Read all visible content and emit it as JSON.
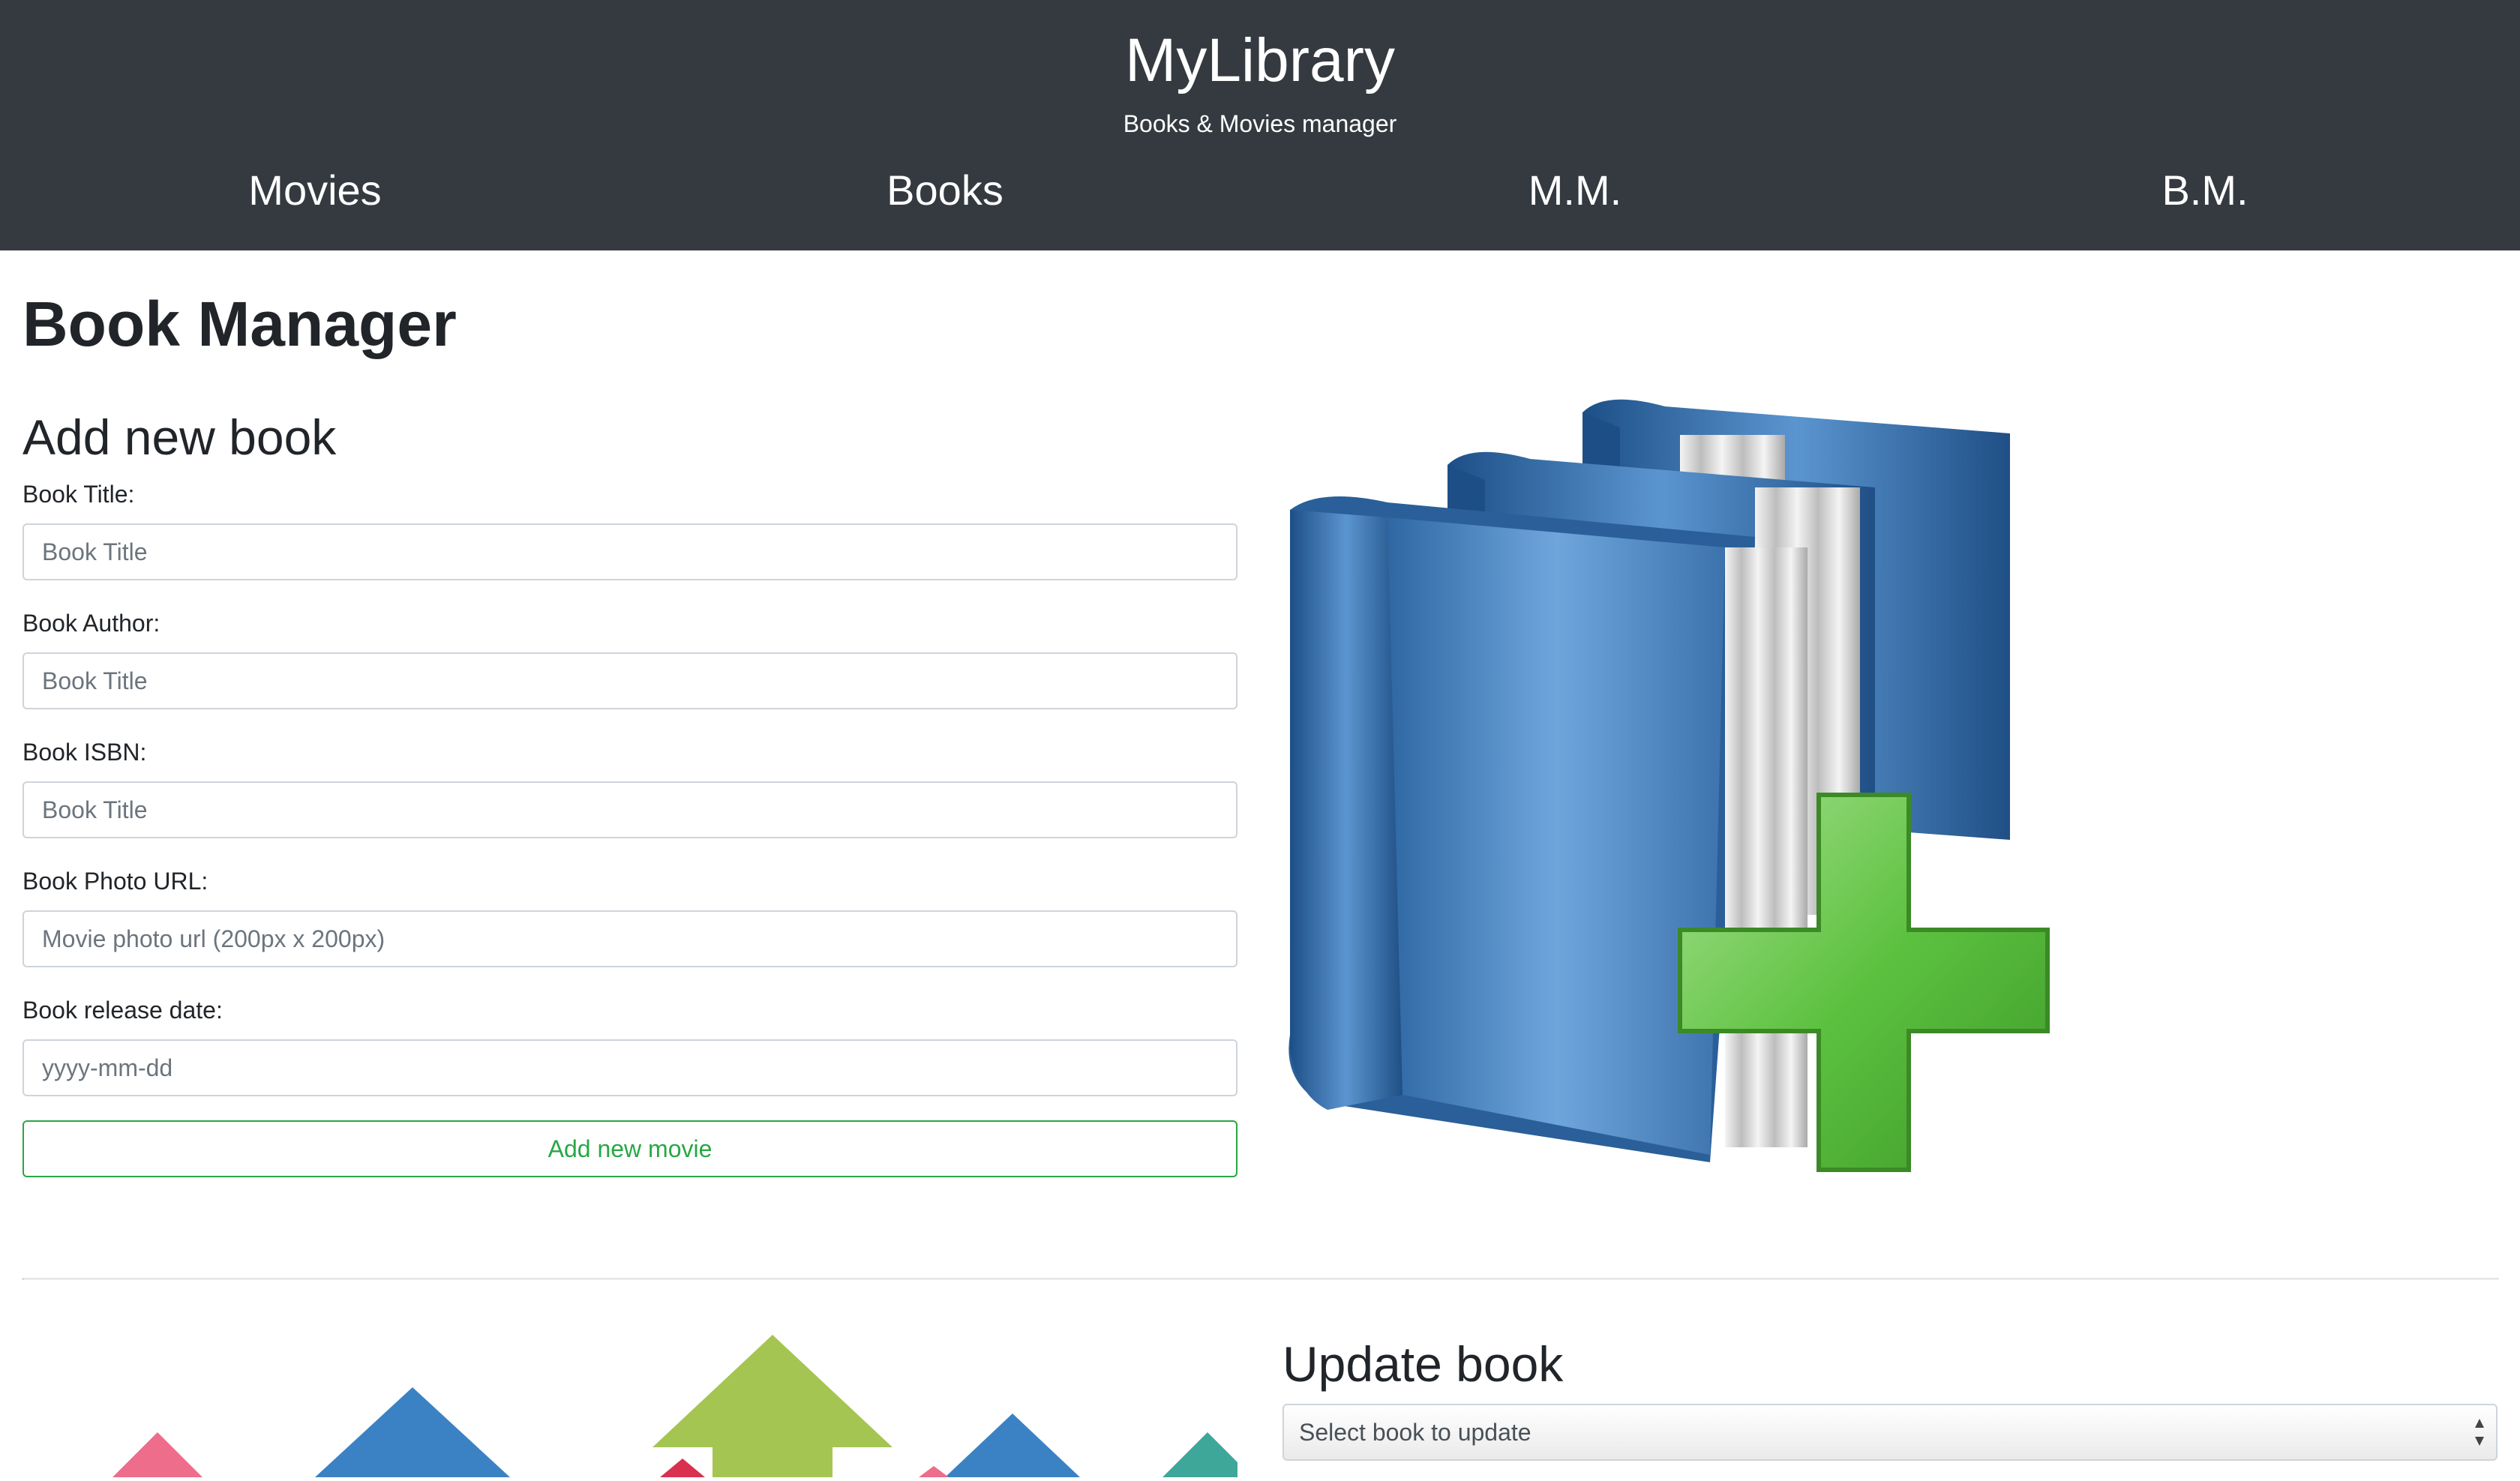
{
  "header": {
    "brand": "MyLibrary",
    "tagline": "Books & Movies manager",
    "nav": [
      "Movies",
      "Books",
      "M.M.",
      "B.M."
    ]
  },
  "page": {
    "title": "Book Manager"
  },
  "add_form": {
    "title": "Add new book",
    "fields": [
      {
        "label": "Book Title:",
        "placeholder": "Book Title",
        "value": ""
      },
      {
        "label": "Book Author:",
        "placeholder": "Book Title",
        "value": ""
      },
      {
        "label": "Book ISBN:",
        "placeholder": "Book Title",
        "value": ""
      },
      {
        "label": "Book Photo URL:",
        "placeholder": "Movie photo url (200px x 200px)",
        "value": ""
      },
      {
        "label": "Book release date:",
        "placeholder": "yyyy-mm-dd",
        "value": ""
      }
    ],
    "submit_label": "Add new movie"
  },
  "update_form": {
    "title": "Update book",
    "select_value": "Select book to update"
  },
  "colors": {
    "header_bg": "#343a40",
    "success": "#28a745",
    "book_blue": "#3d7ab8",
    "plus_green": "#5cc13f"
  },
  "icons": [
    "books-with-plus-icon",
    "arrows-graphic",
    "select-arrows-icon"
  ]
}
